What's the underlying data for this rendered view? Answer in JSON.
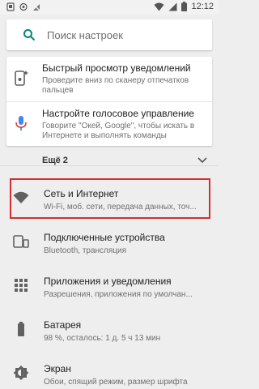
{
  "status_bar": {
    "time": "12:12",
    "left_icons": [
      "notification-icon",
      "app-icon",
      "signal-off-icon"
    ],
    "right_icons": [
      "wifi-icon",
      "signal-icon",
      "battery-icon"
    ]
  },
  "search": {
    "placeholder": "Поиск настроек",
    "icon": "search-icon",
    "accent": "#00897b"
  },
  "suggestions": [
    {
      "title": "Быстрый просмотр уведомлений",
      "subtitle": "Проведите вниз по сканеру отпечатков пальцев",
      "icon": "phone-swipe-icon"
    },
    {
      "title": "Настройте голосовое управление",
      "subtitle": "Говорите \"Окей, Google\", чтобы искать в Интернете и выполнять команды",
      "icon": "microphone-icon"
    }
  ],
  "more": {
    "label": "Ещё 2",
    "icon": "chevron-down-icon"
  },
  "settings": [
    {
      "title": "Сеть и Интернет",
      "subtitle": "Wi-Fi, моб. сети, передача данных, точ...",
      "icon": "wifi-icon"
    },
    {
      "title": "Подключенные устройства",
      "subtitle": "Bluetooth, трансляция",
      "icon": "devices-icon"
    },
    {
      "title": "Приложения и уведомления",
      "subtitle": "Разрешения, приложения по умолчан...",
      "icon": "apps-icon"
    },
    {
      "title": "Батарея",
      "subtitle": "98 %, осталось: 1 д. 5 ч 13 мин",
      "icon": "battery-icon"
    },
    {
      "title": "Экран",
      "subtitle": "Обои, спящий режим, размер шрифта",
      "icon": "display-icon"
    }
  ],
  "colors": {
    "icon_gray": "#616161",
    "highlight": "#d32f2f",
    "mic_blue": "#4285f4"
  }
}
